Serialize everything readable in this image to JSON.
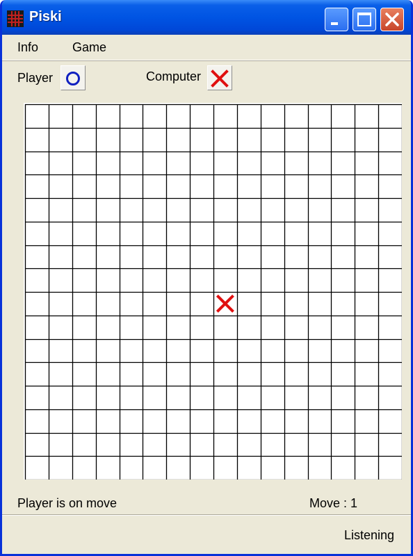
{
  "window": {
    "title": "Piski"
  },
  "menu": {
    "items": [
      "Info",
      "Game"
    ]
  },
  "players": {
    "player_label": "Player",
    "player_symbol": "O",
    "computer_label": "Computer",
    "computer_symbol": "X"
  },
  "board": {
    "columns": 16,
    "rows": 16,
    "moves": [
      {
        "symbol": "X",
        "col": 9,
        "row": 9
      }
    ],
    "colors": {
      "x": "#e01010",
      "o": "#1020c0",
      "grid": "#000000"
    }
  },
  "status": {
    "turn_text": "Player is on move",
    "move_text": "Move : 1",
    "connection_text": "Listening"
  }
}
